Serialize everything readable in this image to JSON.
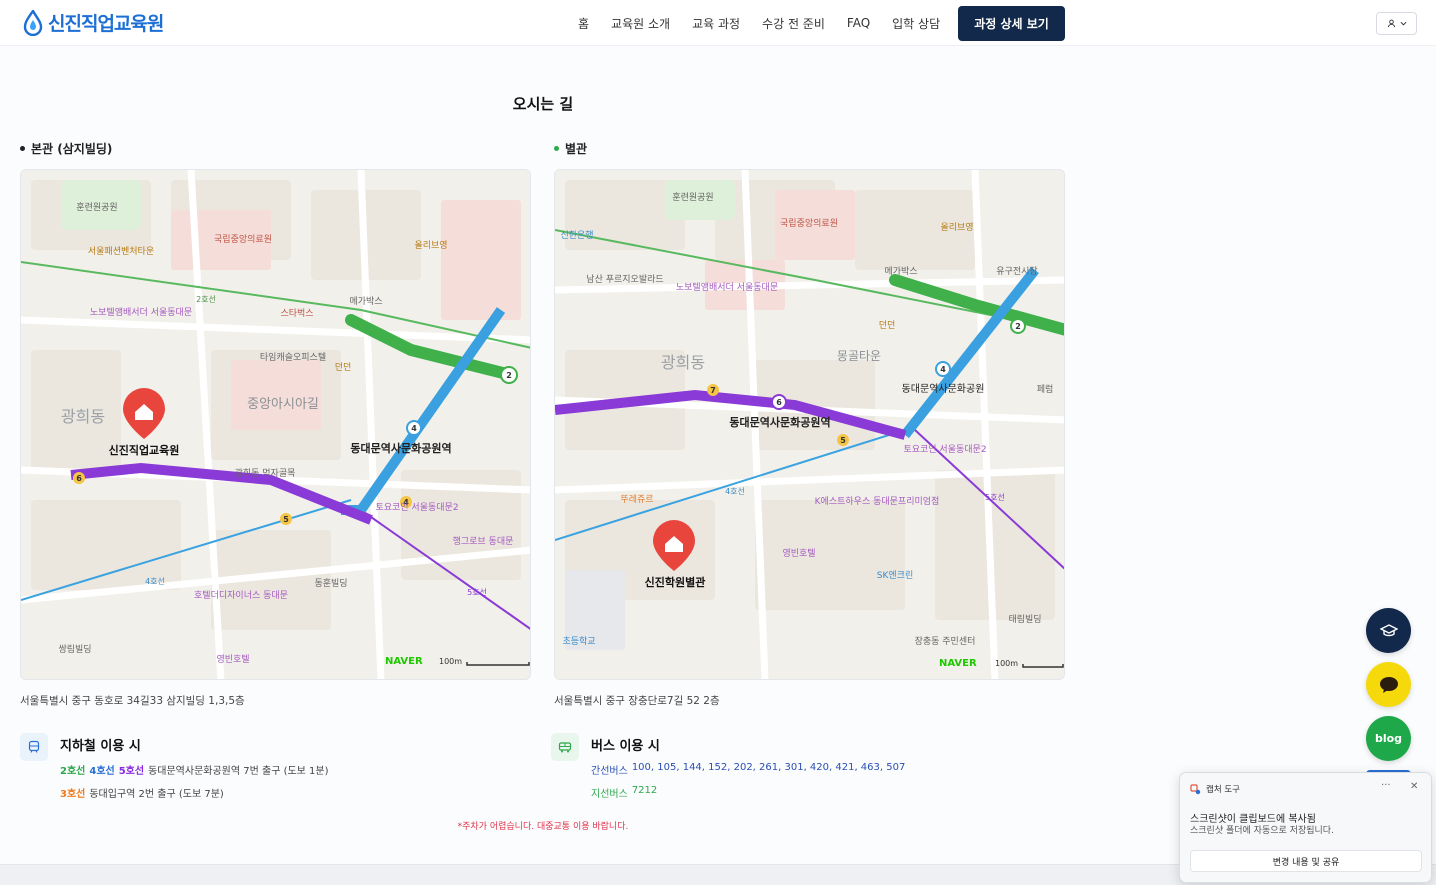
{
  "header": {
    "logo_text": "신진직업교육원",
    "nav": [
      "홈",
      "교육원 소개",
      "교육 과정",
      "수강 전 준비",
      "FAQ",
      "입학 상담"
    ],
    "cta_label": "과정 상세 보기"
  },
  "section_title": "오시는 길",
  "main_building": {
    "label": "본관 (삼지빌딩)",
    "dot_color": "#1f2329",
    "address": "서울특별시 중구 동호로 34길33 삼지빌딩 1,3,5층",
    "map": {
      "marker_label": "신진직업교육원",
      "district": "광희동",
      "station": "동대문역사문화공원역",
      "places": [
        "훈련원공원",
        "국립중앙의료원",
        "올리브영",
        "서울패션벤처타운",
        "노보텔앰배서더 서울동대문",
        "스타벅스",
        "메가박스",
        "타임캐슬오피스텔",
        "던던",
        "중앙아시아길",
        "광희동 먹자골목",
        "동훈빌딩",
        "호텔더디자이너스 동대문",
        "영빈호텔",
        "쌍림빌딩",
        "토요코인 서울동대문2",
        "행그로브 동대문"
      ],
      "line_labels": [
        "2호선",
        "4호선",
        "5호선"
      ],
      "brand": "NAVER",
      "scale": "100m"
    }
  },
  "annex": {
    "label": "별관",
    "dot_color": "#2ea84a",
    "address": "서울특별시 중구 장충단로7길 52 2층",
    "map": {
      "marker_label": "신진학원별관",
      "district": "광희동",
      "station": "동대문역사문화공원역",
      "places": [
        "훈련원공원",
        "국립중앙의료원",
        "올리브영",
        "남산 푸르지오발라드",
        "노보텔앰배서더 서울동대문",
        "메가박스",
        "던던",
        "몽골타운",
        "동대문역사문화공원",
        "유구전시장",
        "뚜레쥬르",
        "K에스트하우스 동대문프리미엄점",
        "영빈호텔",
        "SK엔크린",
        "태림빌딩",
        "장충동 주민센터",
        "초등학교",
        "신한은행",
        "토요코인 서울동대문2",
        "페럼"
      ],
      "line_labels": [
        "4호선",
        "5호선"
      ],
      "brand": "NAVER",
      "scale": "100m"
    }
  },
  "subway": {
    "title": "지하철 이용 시",
    "line1": {
      "l1": "2호선",
      "l2": "4호선",
      "l3": "5호선",
      "desc": "동대문역사문화공원역 7번 출구 (도보 1분)"
    },
    "line2": {
      "l1": "3호선",
      "desc": "동대입구역 2번 출구 (도보 7분)"
    }
  },
  "bus": {
    "title": "버스 이용 시",
    "trunk_label": "간선버스",
    "trunk_numbers": "100, 105, 144, 152, 202, 261, 301, 420, 421, 463, 507",
    "branch_label": "지선버스",
    "branch_numbers": "7212"
  },
  "note": "*주차가 어렵습니다. 대중교통 이용 바랍니다.",
  "floating": {
    "blog_label": "blog",
    "colors": {
      "grad": "#13294b",
      "chat": "#f5d90a",
      "blog": "#1fa84a"
    }
  },
  "toast": {
    "app": "캡처 도구",
    "more": "···",
    "title": "스크린샷이 클립보드에 복사됨",
    "subtitle": "스크린샷 폴더에 자동으로 저장됩니다.",
    "button": "변경 내용 및 공유"
  }
}
